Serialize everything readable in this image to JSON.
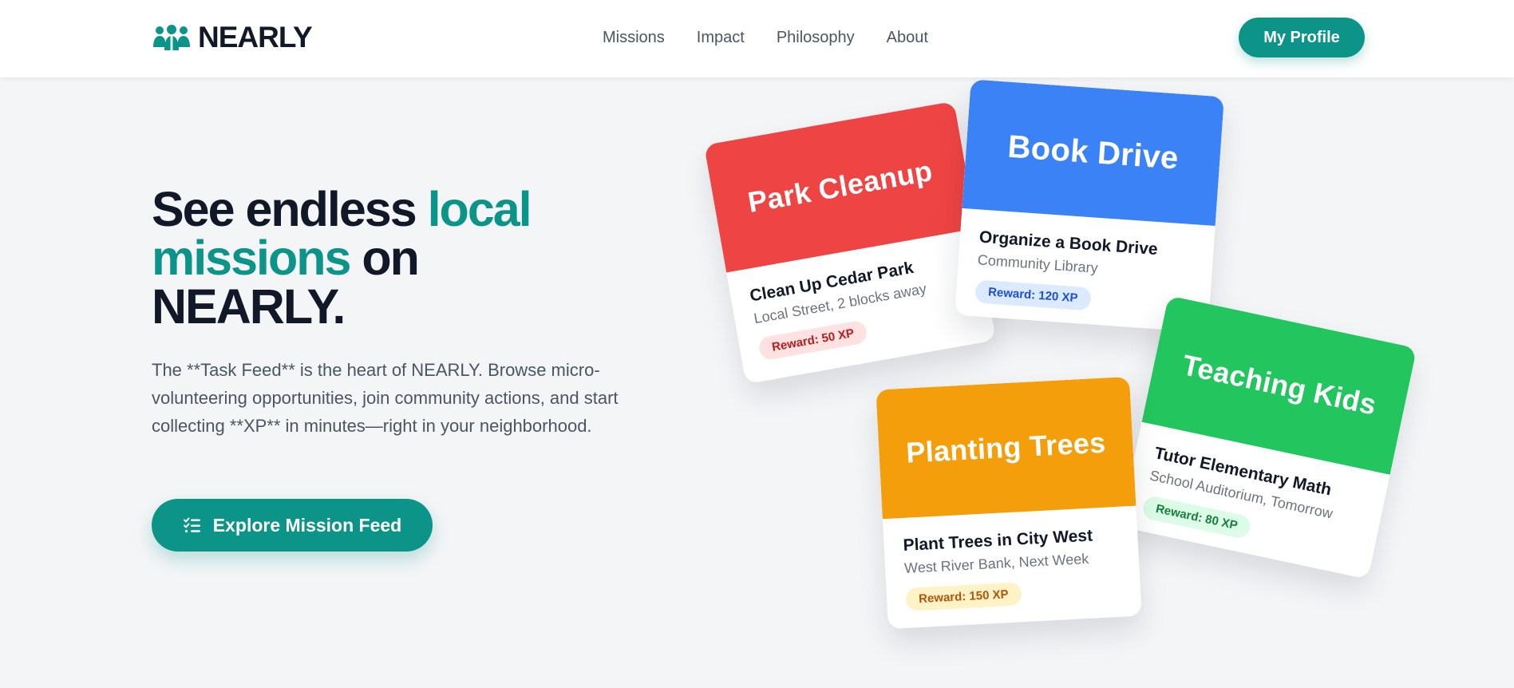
{
  "header": {
    "brand": "NEARLY",
    "nav": [
      "Missions",
      "Impact",
      "Philosophy",
      "About"
    ],
    "profile_label": "My Profile"
  },
  "hero": {
    "title_part1": "See endless ",
    "title_accent1": "local",
    "title_accent2": "missions",
    "title_part2": " on",
    "title_part3": "NEARLY.",
    "description": "The **Task Feed** is the heart of NEARLY. Browse micro-volunteering opportunities, join community actions, and start collecting **XP** in minutes—right in your neighborhood.",
    "cta_label": "Explore Mission Feed",
    "cta_icon": "list-check-icon"
  },
  "colors": {
    "accent": "#0d9488",
    "red": "#ef4444",
    "blue": "#3b82f6",
    "green": "#22c55e",
    "amber": "#f59e0b"
  },
  "cards": [
    {
      "header": "Park Cleanup",
      "title": "Clean Up Cedar Park",
      "subtitle": "Local Street, 2 blocks away",
      "reward": "Reward: 50 XP"
    },
    {
      "header": "Book Drive",
      "title": "Organize a Book Drive",
      "subtitle": "Community Library",
      "reward": "Reward: 120 XP"
    },
    {
      "header": "Teaching Kids",
      "title": "Tutor Elementary Math",
      "subtitle": "School Auditorium, Tomorrow",
      "reward": "Reward: 80 XP"
    },
    {
      "header": "Planting Trees",
      "title": "Plant Trees in City West",
      "subtitle": "West River Bank, Next Week",
      "reward": "Reward: 150 XP"
    }
  ]
}
